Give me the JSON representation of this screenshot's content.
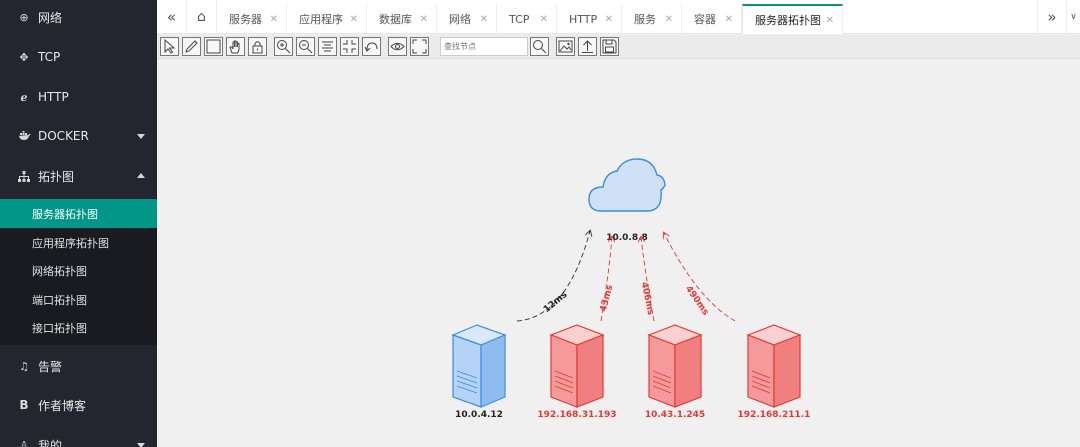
{
  "sidebar": {
    "items": [
      {
        "label": "网络",
        "icon": "globe-icon"
      },
      {
        "label": "TCP",
        "icon": "crosshair-icon"
      },
      {
        "label": "HTTP",
        "icon": "ie-icon"
      },
      {
        "label": "DOCKER",
        "icon": "docker-icon"
      },
      {
        "label": "拓扑图",
        "icon": "sitemap-icon"
      },
      {
        "label": "告警",
        "icon": "bell-icon"
      },
      {
        "label": "作者博客",
        "icon": "b-icon"
      },
      {
        "label": "我的",
        "icon": "user-icon"
      }
    ],
    "submenu": [
      {
        "label": "服务器拓扑图",
        "active": true
      },
      {
        "label": "应用程序拓扑图"
      },
      {
        "label": "网络拓扑图"
      },
      {
        "label": "端口拓扑图"
      },
      {
        "label": "接口拓扑图"
      }
    ]
  },
  "tabs": [
    {
      "label": "服务器"
    },
    {
      "label": "应用程序"
    },
    {
      "label": "数据库"
    },
    {
      "label": "网络"
    },
    {
      "label": "TCP"
    },
    {
      "label": "HTTP"
    },
    {
      "label": "服务"
    },
    {
      "label": "容器"
    },
    {
      "label": "服务器拓扑图",
      "active": true
    }
  ],
  "toolbar": {
    "search_placeholder": "查找节点"
  },
  "topology": {
    "center_label": "10.0.8.8",
    "nodes": [
      {
        "label": "10.0.4.12",
        "status": "normal",
        "latency": "12ms"
      },
      {
        "label": "192.168.31.193",
        "status": "alert",
        "latency": "43ms"
      },
      {
        "label": "10.43.1.245",
        "status": "alert",
        "latency": "406ms"
      },
      {
        "label": "192.168.211.1",
        "status": "alert",
        "latency": "490ms"
      }
    ],
    "colors": {
      "normal": "#3a8ee6",
      "normal_fill": "#b5d3f5",
      "alert": "#e53935",
      "alert_fill": "#f59a9a",
      "cloud_fill": "#cfe1f7"
    }
  }
}
